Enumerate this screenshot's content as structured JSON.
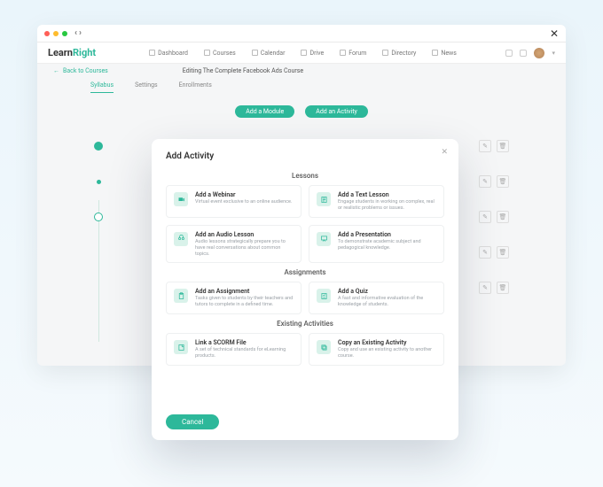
{
  "brand": {
    "part1": "Learn",
    "part2": "Right"
  },
  "nav": [
    {
      "label": "Dashboard"
    },
    {
      "label": "Courses"
    },
    {
      "label": "Calendar"
    },
    {
      "label": "Drive"
    },
    {
      "label": "Forum"
    },
    {
      "label": "Directory"
    },
    {
      "label": "News"
    }
  ],
  "breadcrumb": "Back to Courses",
  "page_title": "Editing The Complete Facebook Ads Course",
  "tabs": {
    "syllabus": "Syllabus",
    "settings": "Settings",
    "enrollments": "Enrollments"
  },
  "buttons": {
    "add_module": "Add a Module",
    "add_activity": "Add an Activity"
  },
  "modal": {
    "title": "Add Activity",
    "sections": {
      "lessons": "Lessons",
      "assignments": "Assignments",
      "existing": "Existing Activities"
    },
    "cards": {
      "webinar": {
        "title": "Add a Webinar",
        "desc": "Virtual event exclusive to an online audience."
      },
      "text": {
        "title": "Add a Text Lesson",
        "desc": "Engage students in working on complex, real or realistic problems or issues."
      },
      "audio": {
        "title": "Add an Audio Lesson",
        "desc": "Audio lessons strategically prepare you to have real conversations about common topics."
      },
      "pres": {
        "title": "Add a Presentation",
        "desc": "To demonstrate academic subject and pedagogical knowledge."
      },
      "assign": {
        "title": "Add an Assignment",
        "desc": "Tasks given to students by their teachers and tutors to complete in a defined time."
      },
      "quiz": {
        "title": "Add a Quiz",
        "desc": "A fast and informative evaluation of the knowledge of students."
      },
      "scorm": {
        "title": "Link a SCORM File",
        "desc": "A set of technical standards for eLearning products."
      },
      "copy": {
        "title": "Copy an Existing Activity",
        "desc": "Copy and use an existing activity to another course."
      }
    },
    "cancel": "Cancel"
  }
}
